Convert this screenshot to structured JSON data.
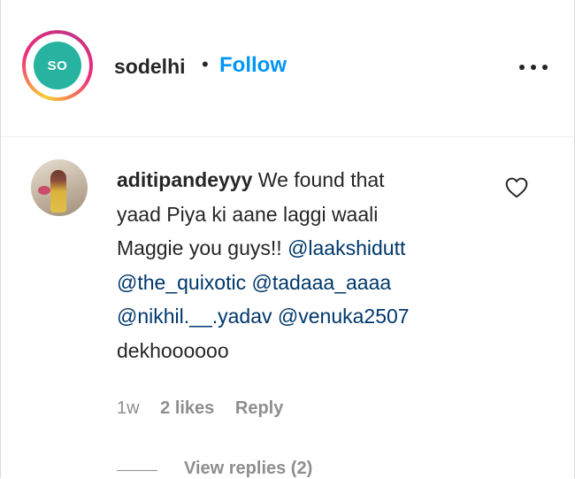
{
  "post": {
    "username": "sodelhi",
    "separator": "•",
    "follow_label": "Follow",
    "avatar_text": "SO",
    "more_icon": "more-options-icon"
  },
  "comment": {
    "username": "aditipandeyyy",
    "text_lines": [
      "We found that",
      "yaad Piya ki aane laggi waali",
      "Maggie you guys!!"
    ],
    "mentions": [
      "@laakshidutt",
      "@the_quixotic",
      "@tadaaa_aaaa",
      "@nikhil.__.yadav",
      "@venuka2507"
    ],
    "closing_text": "dekhoooooo",
    "time": "1w",
    "likes": "2 likes",
    "reply_label": "Reply",
    "view_replies_label": "View replies (2)",
    "like_icon": "heart-icon"
  },
  "colors": {
    "follow_blue": "#0095f6",
    "mention_blue": "#00376b",
    "meta_gray": "#8e8e8e",
    "brand_teal": "#27b3a0"
  }
}
